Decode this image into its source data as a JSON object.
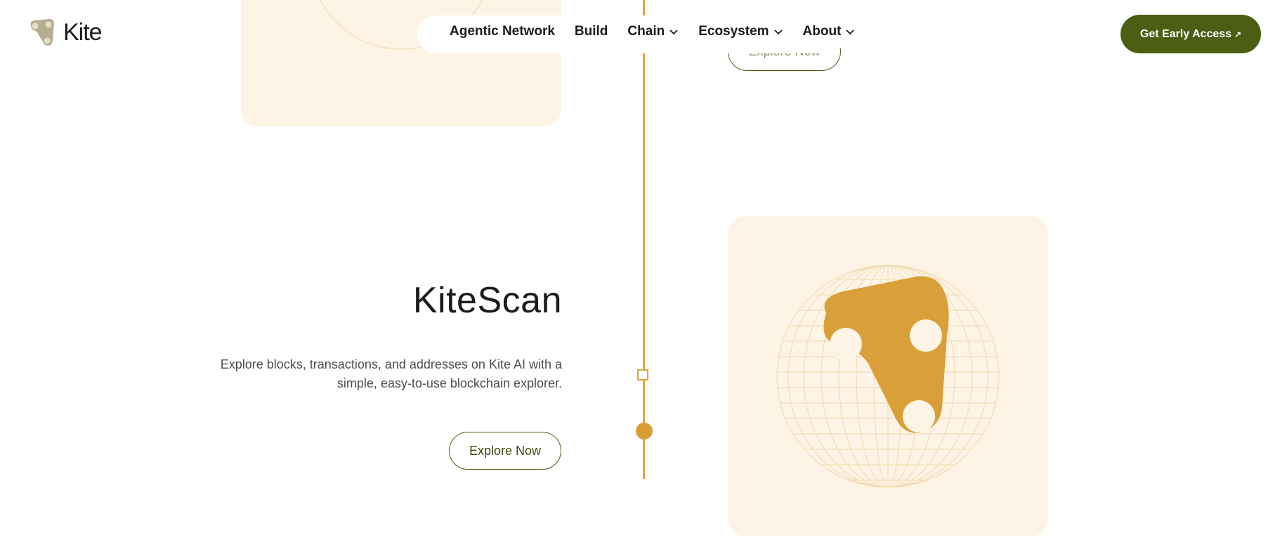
{
  "brand": {
    "name": "Kite",
    "icon": "kite-logo-icon"
  },
  "nav": {
    "items": [
      {
        "label": "Agentic Network",
        "has_dropdown": false
      },
      {
        "label": "Build",
        "has_dropdown": false
      },
      {
        "label": "Chain",
        "has_dropdown": true
      },
      {
        "label": "Ecosystem",
        "has_dropdown": true
      },
      {
        "label": "About",
        "has_dropdown": true
      }
    ]
  },
  "cta": {
    "label": "Get Early Access",
    "arrow": "↗"
  },
  "previous_section": {
    "button_label": "Explore Now"
  },
  "section": {
    "title": "KiteScan",
    "description": "Explore blocks, transactions, and addresses on Kite AI with a simple, easy-to-use blockchain explorer.",
    "button_label": "Explore Now",
    "illustration_icon": "kite-globe-icon"
  },
  "colors": {
    "accent": "#d99e33",
    "cta_bg": "#4b5e14",
    "card_bg": "#fdf4e6"
  }
}
